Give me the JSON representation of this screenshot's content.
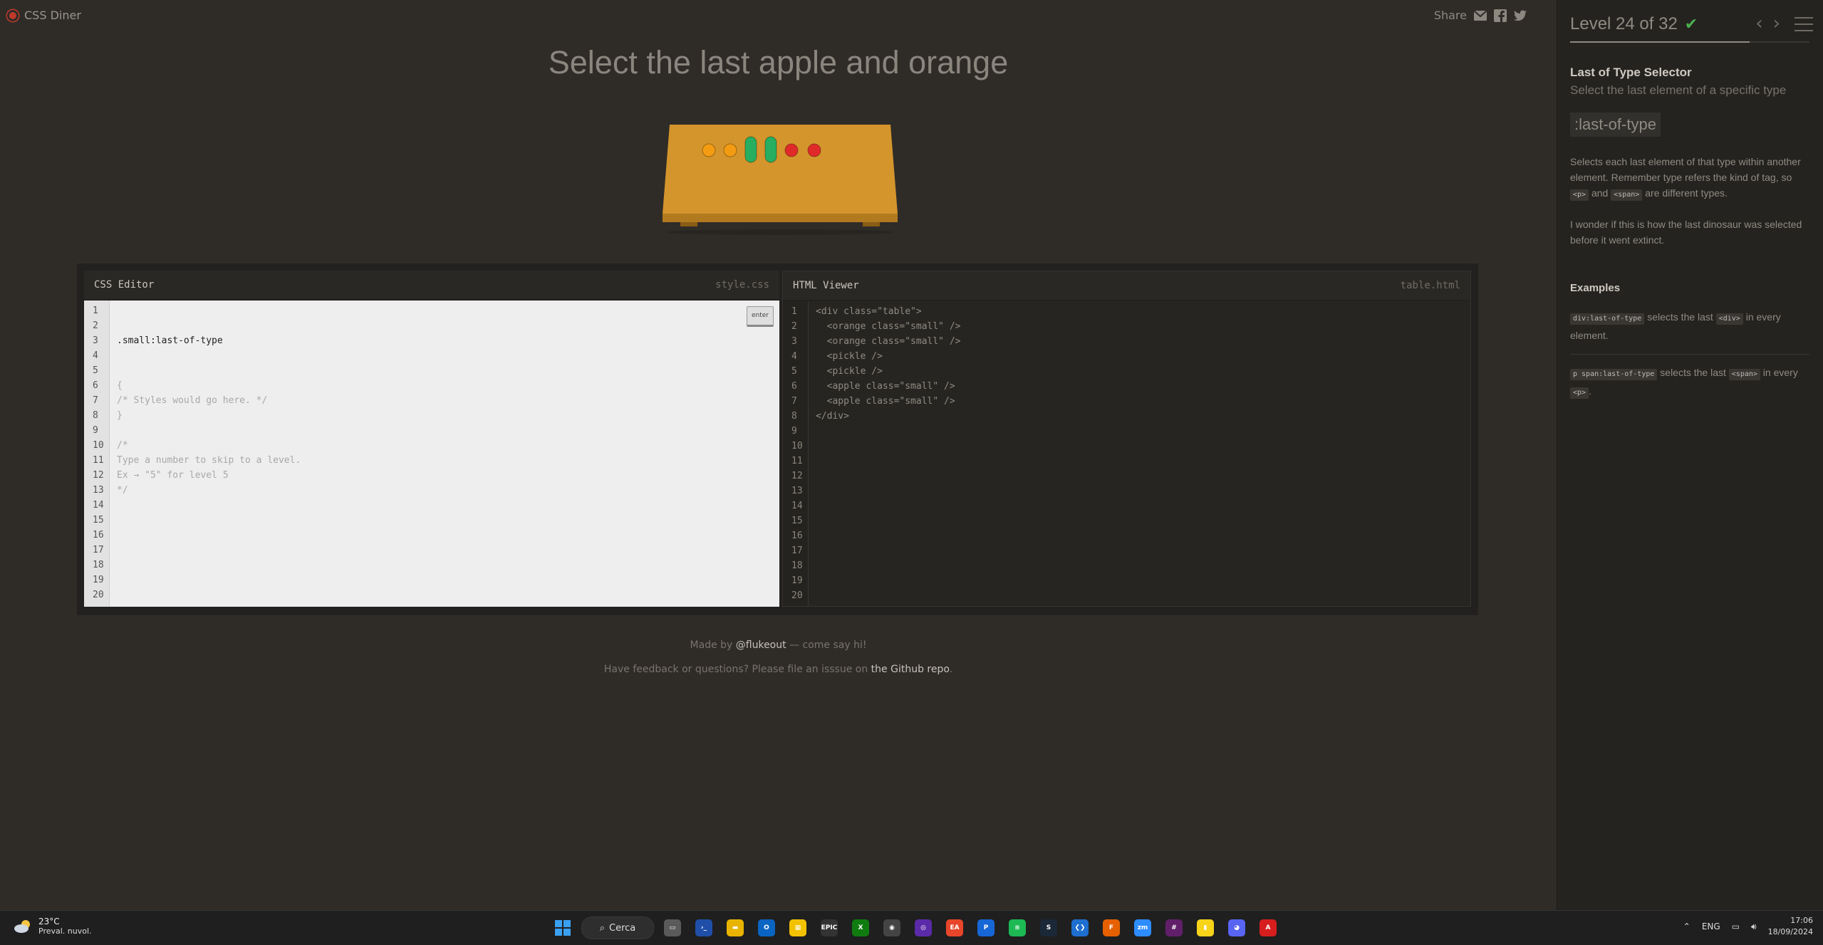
{
  "app": {
    "name": "CSS Diner",
    "share_label": "Share"
  },
  "instruction": "Select the last apple and orange",
  "plate_items": [
    {
      "kind": "orange",
      "color": "#f39c12"
    },
    {
      "kind": "orange",
      "color": "#f39c12"
    },
    {
      "kind": "pickle",
      "color": "#27ae60"
    },
    {
      "kind": "pickle",
      "color": "#27ae60"
    },
    {
      "kind": "apple",
      "color": "#e02a2a"
    },
    {
      "kind": "apple",
      "color": "#e02a2a"
    }
  ],
  "css_editor": {
    "title": "CSS Editor",
    "file": "style.css",
    "input_value": ".small:last-of-type",
    "enter_label": "enter",
    "lines": [
      "{",
      "/* Styles would go here. */",
      "}",
      "",
      "/*",
      "Type a number to skip to a level.",
      "Ex → \"5\" for level 5",
      "*/"
    ],
    "line_numbers": [
      "1",
      "2",
      "3",
      "4",
      "5",
      "6",
      "7",
      "8",
      "9",
      "10",
      "11",
      "12",
      "13",
      "14",
      "15",
      "16",
      "17",
      "18",
      "19",
      "20"
    ]
  },
  "html_viewer": {
    "title": "HTML Viewer",
    "file": "table.html",
    "lines": [
      "<div class=\"table\">",
      "  <orange class=\"small\" />",
      "  <orange class=\"small\" />",
      "  <pickle />",
      "  <pickle />",
      "  <apple class=\"small\" />",
      "  <apple class=\"small\" />",
      "</div>"
    ],
    "line_numbers": [
      "1",
      "2",
      "3",
      "4",
      "5",
      "6",
      "7",
      "8",
      "9",
      "10",
      "11",
      "12",
      "13",
      "14",
      "15",
      "16",
      "17",
      "18",
      "19",
      "20"
    ]
  },
  "footer": {
    "made_by_prefix": "Made by ",
    "made_by_link": "@flukeout",
    "made_by_suffix": " — come say hi!",
    "feedback_prefix": "Have feedback or questions? Please file an isssue on ",
    "feedback_link": "the Github repo",
    "feedback_suffix": "."
  },
  "sidebar": {
    "level_label": "Level 24 of 32",
    "completed": true,
    "progress": 0.75,
    "selector_name": "Last of Type Selector",
    "selector_title": "Select the last element of a specific type",
    "syntax": ":last-of-type",
    "desc_part1": "Selects each last element of that type within another element. Remember type refers the kind of tag, so ",
    "desc_tag1": "<p>",
    "desc_and": " and ",
    "desc_tag2": "<span>",
    "desc_part2": " are different types.",
    "desc2": "I wonder if this is how the last dinosaur was selected before it went extinct.",
    "examples_title": "Examples",
    "ex1_code": "div:last-of-type",
    "ex1_text1": " selects the last ",
    "ex1_tag": "<div>",
    "ex1_text2": " in every element.",
    "ex2_code": "p span:last-of-type",
    "ex2_text1": " selects the last ",
    "ex2_tag": "<span>",
    "ex2_text2": " in every ",
    "ex2_tag2": "<p>",
    "ex2_text3": "."
  },
  "taskbar": {
    "weather_temp": "23°C",
    "weather_desc": "Preval. nuvol.",
    "search_label": "Cerca",
    "lang": "ENG",
    "time": "17:06",
    "date": "18/09/2024",
    "apps": [
      {
        "name": "task-view",
        "color": "#5a5a5a",
        "glyph": "▭"
      },
      {
        "name": "terminal",
        "color": "#1f4fa8",
        "glyph": "›_"
      },
      {
        "name": "file-explorer",
        "color": "#e8b400",
        "glyph": "▬"
      },
      {
        "name": "outlook",
        "color": "#0a64c2",
        "glyph": "O"
      },
      {
        "name": "store",
        "color": "#f2c200",
        "glyph": "▦"
      },
      {
        "name": "epic-games",
        "color": "#333",
        "glyph": "EPIC"
      },
      {
        "name": "xbox",
        "color": "#107c10",
        "glyph": "X"
      },
      {
        "name": "obs",
        "color": "#444",
        "glyph": "◉"
      },
      {
        "name": "app-purple",
        "color": "#5b2aa8",
        "glyph": "◎"
      },
      {
        "name": "ea",
        "color": "#e8462a",
        "glyph": "EA"
      },
      {
        "name": "playstation",
        "color": "#1766d6",
        "glyph": "P"
      },
      {
        "name": "spotify",
        "color": "#1db954",
        "glyph": "≋"
      },
      {
        "name": "steam",
        "color": "#1b2838",
        "glyph": "S"
      },
      {
        "name": "vscode",
        "color": "#1e6fd0",
        "glyph": "❮❯"
      },
      {
        "name": "firefox",
        "color": "#e66000",
        "glyph": "F"
      },
      {
        "name": "zoom",
        "color": "#2d8cff",
        "glyph": "zm"
      },
      {
        "name": "slack",
        "color": "#611f69",
        "glyph": "#"
      },
      {
        "name": "sticky-notes",
        "color": "#f7d31a",
        "glyph": "▮"
      },
      {
        "name": "discord",
        "color": "#5865f2",
        "glyph": "◕"
      },
      {
        "name": "acrobat",
        "color": "#d71e1e",
        "glyph": "A"
      }
    ]
  }
}
